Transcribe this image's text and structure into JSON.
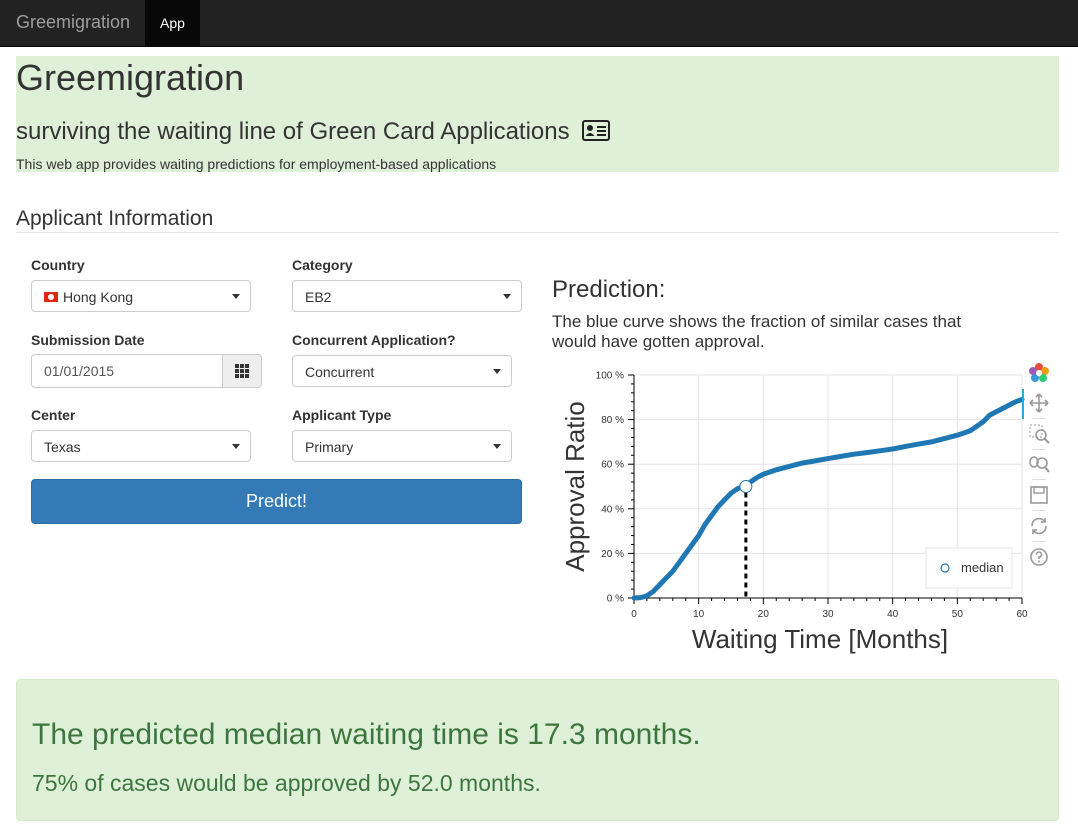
{
  "navbar": {
    "brand": "Greemigration",
    "active_tab": "App"
  },
  "header": {
    "title": "Greemigration",
    "subtitle": "surviving the waiting line of Green Card Applications",
    "subtitle_icon": "id-card-icon",
    "description": "This web app provides waiting predictions for employment-based applications"
  },
  "form": {
    "section_title": "Applicant Information",
    "country": {
      "label": "Country",
      "value": "Hong Kong",
      "flag": "hong-kong-flag"
    },
    "category": {
      "label": "Category",
      "value": "EB2"
    },
    "submission_date": {
      "label": "Submission Date",
      "value": "01/01/2015",
      "icon": "calendar-grid-icon"
    },
    "concurrent": {
      "label": "Concurrent Application?",
      "value": "Concurrent"
    },
    "center": {
      "label": "Center",
      "value": "Texas"
    },
    "applicant_type": {
      "label": "Applicant Type",
      "value": "Primary"
    },
    "predict_label": "Predict!"
  },
  "prediction": {
    "title": "Prediction:",
    "description": "The blue curve shows the fraction of similar cases that would have gotten approval."
  },
  "chart_data": {
    "type": "line",
    "title": "",
    "xlabel": "Waiting Time [Months]",
    "ylabel": "Approval Ratio",
    "xlim": [
      0,
      60
    ],
    "ylim": [
      0,
      100
    ],
    "x_ticks": [
      0,
      10,
      20,
      30,
      40,
      50,
      60
    ],
    "y_ticks": [
      0,
      20,
      40,
      60,
      80,
      100
    ],
    "y_tick_labels": [
      "0 %",
      "20 %",
      "40 %",
      "60 %",
      "80 %",
      "100 %"
    ],
    "grid": true,
    "legend": {
      "placement": "bottom-right",
      "entries": [
        "median"
      ]
    },
    "series": [
      {
        "color": "#1f77b4",
        "x": [
          0,
          1,
          2,
          3,
          4,
          5,
          6,
          7,
          8,
          9,
          10,
          11,
          12,
          13,
          14,
          15,
          16,
          17.3,
          18,
          19,
          20,
          22,
          24,
          26,
          28,
          30,
          32,
          34,
          36,
          38,
          40,
          42,
          44,
          46,
          48,
          50,
          51,
          52,
          53,
          54,
          55,
          57,
          59,
          60
        ],
        "y": [
          0,
          0.2,
          1,
          3,
          6,
          9,
          12,
          16,
          20,
          24,
          28,
          33,
          37,
          41,
          44,
          47,
          49,
          50.5,
          52,
          54,
          55.5,
          57.5,
          59,
          60.5,
          61.5,
          62.5,
          63.5,
          64.5,
          65.2,
          66,
          66.8,
          68,
          69,
          70,
          71.5,
          73,
          74,
          75,
          77,
          79,
          82,
          85,
          88,
          89
        ]
      }
    ],
    "median": {
      "x": 17.3,
      "y": 50,
      "label": "median"
    }
  },
  "result": {
    "main": "The predicted median waiting time is 17.3 months.",
    "sub": "75% of cases would be approved by 52.0 months."
  },
  "toolbar": {
    "tools": [
      "bokeh-logo-icon",
      "pan-icon",
      "box-zoom-icon",
      "wheel-zoom-icon",
      "save-icon",
      "reset-icon",
      "help-icon"
    ]
  }
}
